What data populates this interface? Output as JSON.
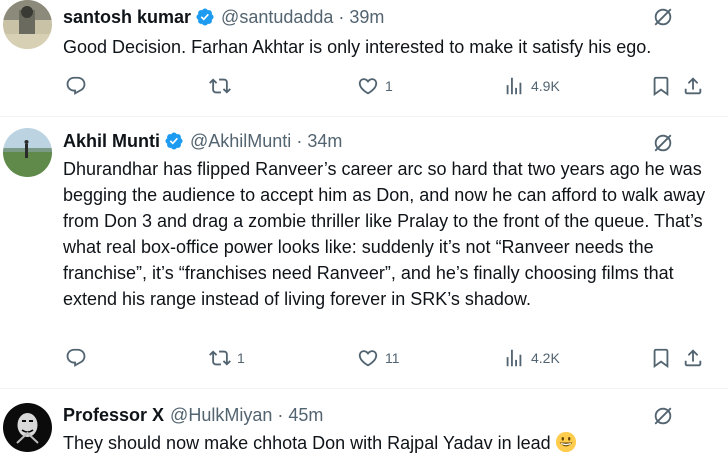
{
  "tweets": [
    {
      "name": "santosh kumar",
      "handle": "@santudadda",
      "separator": "·",
      "time": "39m",
      "text": "Good Decision. Farhan Akhtar is only interested to make it satisfy his ego.",
      "verified": true,
      "stats": {
        "replies": "",
        "reposts": "",
        "likes": "1",
        "views": "4.9K"
      }
    },
    {
      "name": "Akhil Munti",
      "handle": "@AkhilMunti",
      "separator": "·",
      "time": "34m",
      "text": "Dhurandhar has flipped Ranveer’s career arc so hard that two years ago he was begging the audience to accept him as Don, and now he can afford to walk away from Don 3 and drag a zombie thriller like Pralay to the front of the queue. That’s what real box-office power looks like: suddenly it’s not “Ranveer needs the franchise”, it’s “franchises need Ranveer”, and he’s finally choosing films that extend his range instead of living forever in SRK’s shadow.",
      "verified": true,
      "stats": {
        "replies": "",
        "reposts": "1",
        "likes": "11",
        "views": "4.2K"
      }
    },
    {
      "name": "Professor X",
      "handle": "@HulkMiyan",
      "separator": "·",
      "time": "45m",
      "text": "They should now make chhota Don with Rajpal Yadav in lead",
      "emoji": "grinning-face-emoji",
      "verified": false
    }
  ],
  "icons": {
    "reply": "reply-icon",
    "repost": "repost-icon",
    "like": "heart-icon",
    "views": "views-chart-icon",
    "bookmark": "bookmark-icon",
    "share": "share-icon",
    "grok": "grok-icon",
    "verified": "verified-badge-icon"
  },
  "colors": {
    "text": "#0f1419",
    "muted": "#536471",
    "verified": "#1d9bf0",
    "divider": "#eff3f4"
  }
}
